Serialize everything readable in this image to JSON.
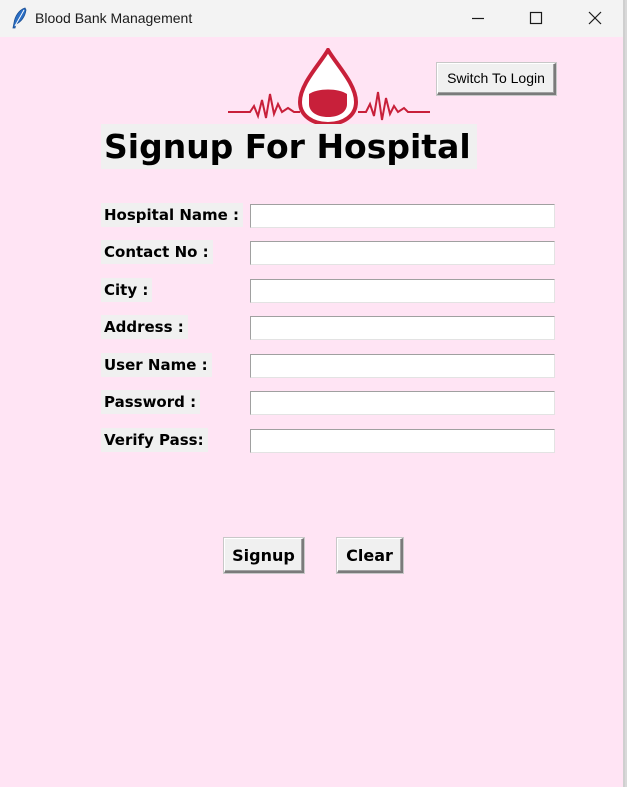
{
  "window": {
    "title": "Blood Bank Management",
    "app_icon": "feather-icon",
    "controls": [
      "minimize-icon",
      "maximize-icon",
      "close-icon"
    ]
  },
  "header": {
    "switch_label": "Switch To Login",
    "logo_icon": "blood-drop-heartbeat-icon"
  },
  "form": {
    "heading": "Signup For Hospital",
    "fields": [
      {
        "label": "Hospital Name :",
        "value": ""
      },
      {
        "label": "Contact No :",
        "value": ""
      },
      {
        "label": "City :",
        "value": ""
      },
      {
        "label": "Address :",
        "value": ""
      },
      {
        "label": "User Name :",
        "value": ""
      },
      {
        "label": "Password :",
        "value": ""
      },
      {
        "label": "Verify Pass:",
        "value": ""
      }
    ],
    "signup_label": "Signup",
    "clear_label": "Clear"
  },
  "colors": {
    "background": "#ffe4f4",
    "widget": "#f0f0f0",
    "logo_red": "#c8203a"
  }
}
